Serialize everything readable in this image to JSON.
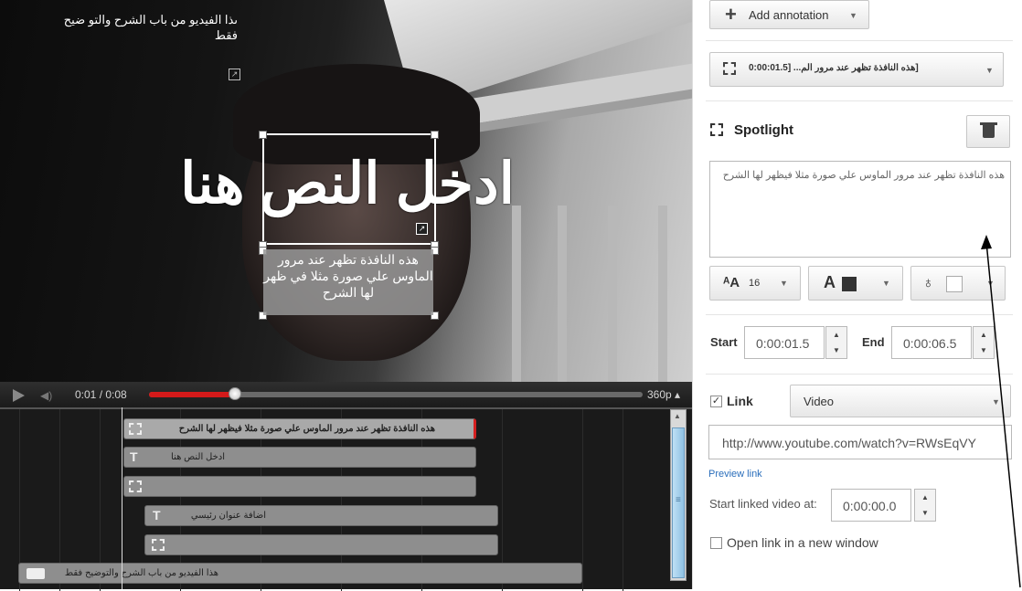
{
  "video": {
    "top_annotation_text": "ىذا الفيديو من باب الشرح والتو ضيح فقط",
    "big_text": "ادخل النص هنا",
    "spotlight_tooltip": "هذه النافذة تظهر عند مرور الماوس علي صورة مثلا في ظهر لها الشرح"
  },
  "player": {
    "time": "0:01 / 0:08",
    "quality": "360p",
    "progress": 0.16
  },
  "timeline": {
    "tracks": [
      {
        "type": "spotlight",
        "label": "هذه النافذة تظهر عند مرور الماوس علي صورة مثلا فيظهر لها الشرح",
        "selected": true
      },
      {
        "type": "text",
        "label": "ادخل النص هنا"
      },
      {
        "type": "spotlight",
        "label": ""
      },
      {
        "type": "text",
        "label": "اضافة عنوان رئيسي"
      },
      {
        "type": "spotlight",
        "label": ""
      },
      {
        "type": "speech",
        "label": "هذا الفيديو من باب الشرح والتوضيح فقط"
      }
    ]
  },
  "panel": {
    "add_annotation": "Add annotation",
    "annotation_select": "[هذه النافذة تظهر عند مرور الم... [0:00:01.5",
    "type_title": "Spotlight",
    "textarea_value": "هذه النافذة تظهر عند مرور الماوس علي صورة مثلا فيظهر لها الشرح",
    "font_size": "16",
    "text_color": "#333333",
    "bg_color": "#ffffff",
    "start_label": "Start",
    "start_value": "0:00:01.5",
    "end_label": "End",
    "end_value": "0:00:06.5",
    "link_label": "Link",
    "link_checked": true,
    "link_type": "Video",
    "link_url": "http://www.youtube.com/watch?v=RWsEqVY",
    "preview_link": "Preview link",
    "start_linked_label": "Start linked video at:",
    "start_linked_value": "0:00:00.0",
    "open_new_window": "Open link in a new window",
    "open_new_window_checked": false
  }
}
